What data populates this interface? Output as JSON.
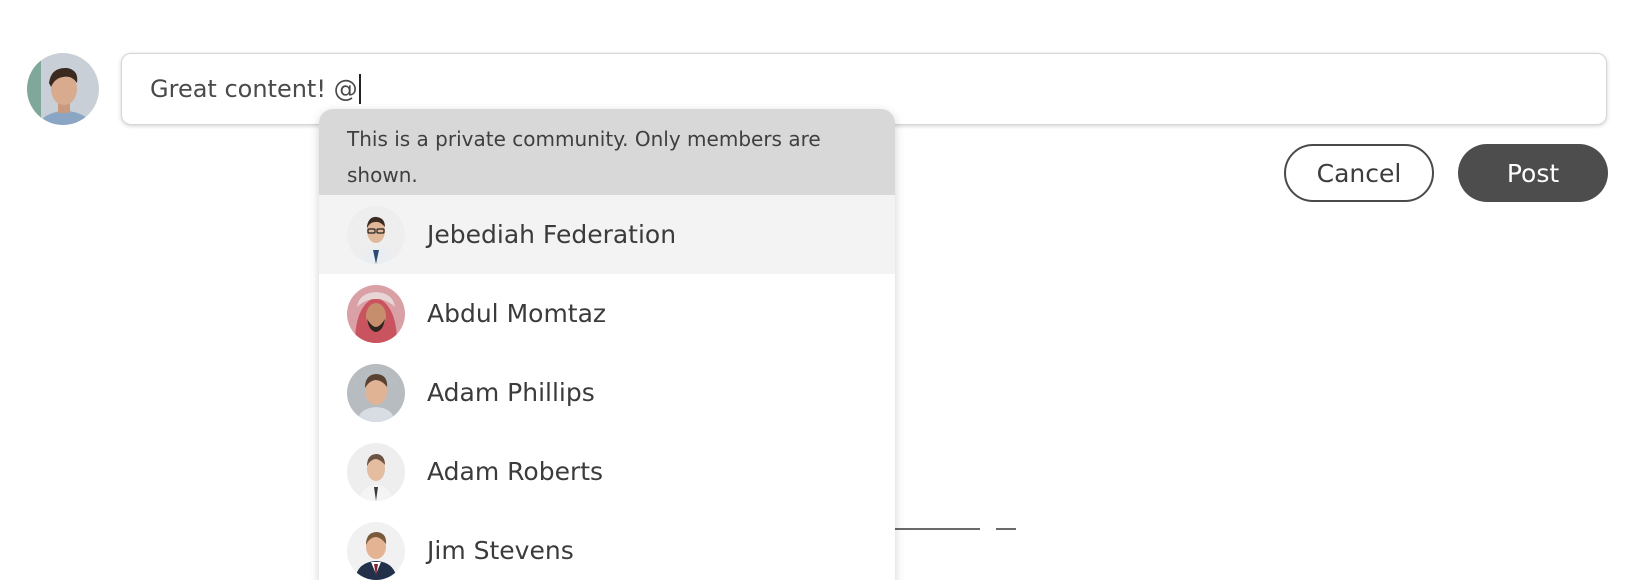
{
  "current_user": {
    "avatar_icon": "user-avatar-photo"
  },
  "comment": {
    "value": "Great content! @"
  },
  "actions": {
    "cancel_label": "Cancel",
    "post_label": "Post"
  },
  "mention_dropdown": {
    "notice": "This is a private community. Only members are shown.",
    "members": [
      {
        "name": "Jebediah Federation",
        "active": true
      },
      {
        "name": "Abdul Momtaz",
        "active": false
      },
      {
        "name": "Adam Phillips",
        "active": false
      },
      {
        "name": "Adam Roberts",
        "active": false
      },
      {
        "name": "Jim Stevens",
        "active": false
      }
    ]
  },
  "colors": {
    "post_button": "#4d4d4d",
    "notice_background": "#d8d8d8",
    "active_row": "#f3f3f3"
  }
}
